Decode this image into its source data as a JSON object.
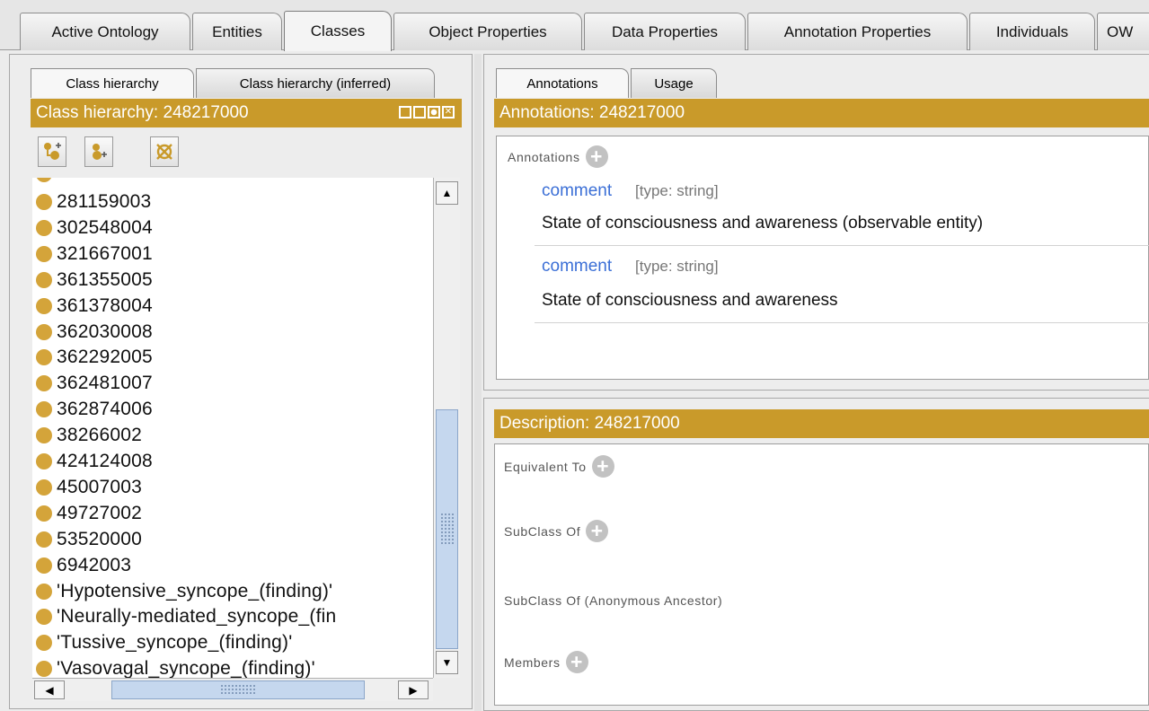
{
  "top_tabs": [
    {
      "label": "Active Ontology"
    },
    {
      "label": "Entities"
    },
    {
      "label": "Classes"
    },
    {
      "label": "Object Properties"
    },
    {
      "label": "Data Properties"
    },
    {
      "label": "Annotation Properties"
    },
    {
      "label": "Individuals"
    },
    {
      "label": "OW"
    }
  ],
  "left_panel": {
    "tabs": [
      {
        "label": "Class hierarchy"
      },
      {
        "label": "Class hierarchy (inferred)"
      }
    ],
    "header": "Class hierarchy: 248217000",
    "classes": [
      {
        "label": "281159003"
      },
      {
        "label": "302548004"
      },
      {
        "label": "321667001"
      },
      {
        "label": "361355005"
      },
      {
        "label": "361378004"
      },
      {
        "label": "362030008"
      },
      {
        "label": "362292005"
      },
      {
        "label": "362481007"
      },
      {
        "label": "362874006"
      },
      {
        "label": "38266002"
      },
      {
        "label": "424124008"
      },
      {
        "label": "45007003"
      },
      {
        "label": "49727002"
      },
      {
        "label": "53520000"
      },
      {
        "label": "6942003"
      },
      {
        "label": "'Hypotensive_syncope_(finding)'"
      },
      {
        "label": "'Neurally-mediated_syncope_(fin"
      },
      {
        "label": "'Tussive_syncope_(finding)'"
      },
      {
        "label": "'Vasovagal_syncope_(finding)'"
      }
    ]
  },
  "right_panel": {
    "tabs": [
      {
        "label": "Annotations"
      },
      {
        "label": "Usage"
      }
    ],
    "annotations_header": "Annotations: 248217000",
    "annotations_label": "Annotations",
    "annotations": [
      {
        "property": "comment",
        "type": "[type: string]",
        "value": "State of consciousness and awareness (observable entity)"
      },
      {
        "property": "comment",
        "type": "[type: string]",
        "value": "State of consciousness and awareness"
      }
    ],
    "description_header": "Description: 248217000",
    "sections": [
      {
        "label": "Equivalent To"
      },
      {
        "label": "SubClass Of"
      },
      {
        "label": "SubClass Of (Anonymous Ancestor)"
      },
      {
        "label": "Members"
      }
    ]
  },
  "colors": {
    "accent": "#c99a2a",
    "link": "#3b6fd6",
    "class_dot": "#d4a43a"
  }
}
